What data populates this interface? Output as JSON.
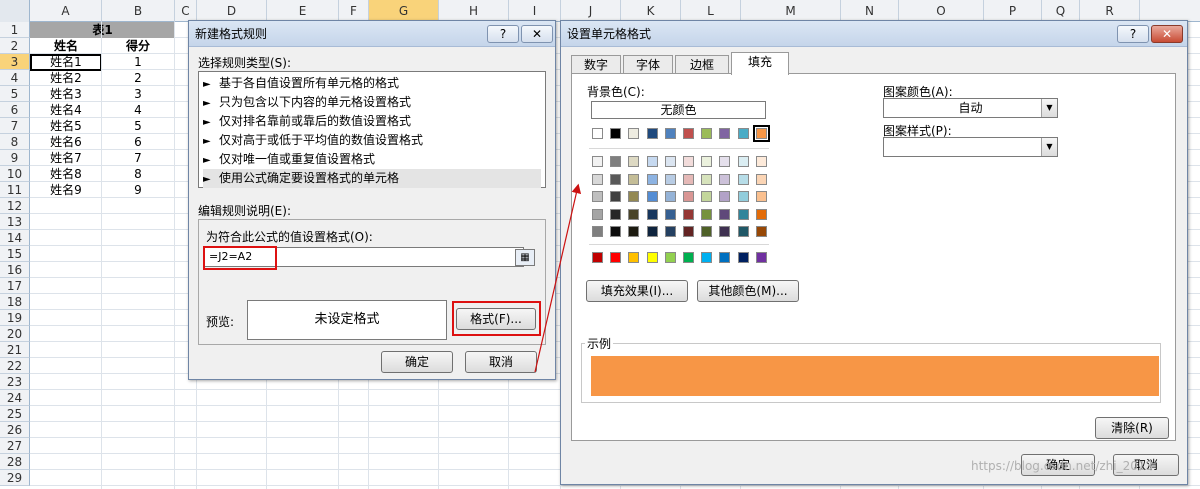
{
  "sheet": {
    "columns": [
      "A",
      "B",
      "C",
      "D",
      "E",
      "F",
      "G",
      "H",
      "I",
      "J",
      "K",
      "L",
      "M",
      "N",
      "O",
      "P",
      "Q",
      "R"
    ],
    "selected_column": "G",
    "rows": [
      "1",
      "2",
      "3",
      "4",
      "5",
      "6",
      "7",
      "8",
      "9",
      "10",
      "11",
      "12",
      "13",
      "14",
      "15",
      "16",
      "17",
      "18",
      "19",
      "20",
      "21",
      "22",
      "23",
      "24",
      "25",
      "26",
      "27",
      "28",
      "29"
    ],
    "selected_row": "3",
    "title_cell": "表1",
    "headers": [
      "姓名",
      "得分"
    ],
    "data": [
      [
        "姓名1",
        "1"
      ],
      [
        "姓名2",
        "2"
      ],
      [
        "姓名3",
        "3"
      ],
      [
        "姓名4",
        "4"
      ],
      [
        "姓名5",
        "5"
      ],
      [
        "姓名6",
        "6"
      ],
      [
        "姓名7",
        "7"
      ],
      [
        "姓名8",
        "8"
      ],
      [
        "姓名9",
        "9"
      ]
    ]
  },
  "dlg1": {
    "title": "新建格式规则",
    "help": "?",
    "close": "✕",
    "select_type_label": "选择规则类型(S):",
    "rule_types": [
      "基于各自值设置所有单元格的格式",
      "只为包含以下内容的单元格设置格式",
      "仅对排名靠前或靠后的数值设置格式",
      "仅对高于或低于平均值的数值设置格式",
      "仅对唯一值或重复值设置格式",
      "使用公式确定要设置格式的单元格"
    ],
    "selected_rule_index": 5,
    "edit_desc_label": "编辑规则说明(E):",
    "formula_label": "为符合此公式的值设置格式(O):",
    "formula_value": "=J2=A2",
    "preview_label": "预览:",
    "preview_text": "未设定格式",
    "format_button": "格式(F)...",
    "ok": "确定",
    "cancel": "取消"
  },
  "dlg2": {
    "title": "设置单元格格式",
    "help": "?",
    "close": "✕",
    "tabs": [
      "数字",
      "字体",
      "边框",
      "填充"
    ],
    "active_tab": "填充",
    "bg_color_label": "背景色(C):",
    "no_color": "无颜色",
    "pattern_color_label": "图案颜色(A):",
    "pattern_color_value": "自动",
    "pattern_style_label": "图案样式(P):",
    "pattern_style_value": "",
    "fill_effects": "填充效果(I)...",
    "more_colors": "其他颜色(M)...",
    "sample_label": "示例",
    "sample_color": "#F79646",
    "clear": "清除(R)",
    "ok": "确定",
    "cancel": "取消",
    "watermark": "https://blog.csdn.net/zhi_2013"
  },
  "palette": {
    "theme_row": [
      "#FFFFFF",
      "#000000",
      "#EEECE1",
      "#1F497D",
      "#4F81BD",
      "#C0504D",
      "#9BBB59",
      "#8064A2",
      "#4BACC6",
      "#F79646"
    ],
    "selected_theme_index": 9,
    "tints": [
      [
        "#F2F2F2",
        "#7F7F7F",
        "#DDD9C3",
        "#C6D9F0",
        "#DBE5F1",
        "#F2DCDB",
        "#EBF1DD",
        "#E5E0EC",
        "#DBEEF3",
        "#FDEADA"
      ],
      [
        "#D8D8D8",
        "#595959",
        "#C4BD97",
        "#8DB3E2",
        "#B8CCE4",
        "#E5B9B7",
        "#D7E3BC",
        "#CCC1D9",
        "#B7DDE8",
        "#FBD5B5"
      ],
      [
        "#BFBFBF",
        "#3F3F3F",
        "#938953",
        "#548DD4",
        "#95B3D7",
        "#D99694",
        "#C3D69B",
        "#B2A2C7",
        "#92CDDC",
        "#FAC08F"
      ],
      [
        "#A5A5A5",
        "#262626",
        "#494429",
        "#17365D",
        "#366092",
        "#953734",
        "#76923C",
        "#5F497A",
        "#31859B",
        "#E36C09"
      ],
      [
        "#7F7F7F",
        "#0C0C0C",
        "#1D1B10",
        "#0F243E",
        "#244061",
        "#632423",
        "#4F6128",
        "#3F3151",
        "#205867",
        "#974806"
      ]
    ],
    "standard_row": [
      "#C00000",
      "#FF0000",
      "#FFC000",
      "#FFFF00",
      "#92D050",
      "#00B050",
      "#00B0F0",
      "#0070C0",
      "#002060",
      "#7030A0"
    ]
  },
  "colors": {
    "highlight_red": "#DD1111",
    "arrow_red": "#CC1111"
  }
}
